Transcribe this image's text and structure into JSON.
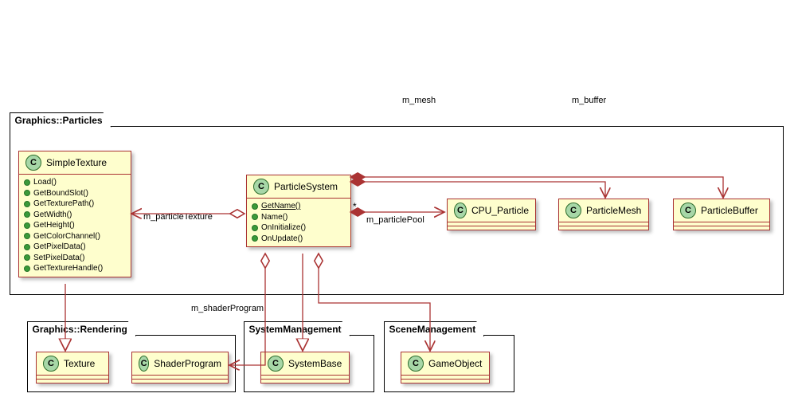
{
  "packages": {
    "particles": "Graphics::Particles",
    "rendering": "Graphics::Rendering",
    "sysmgmt": "SystemManagement",
    "scenemgmt": "SceneManagement"
  },
  "classes": {
    "stereotype": "C",
    "simpleTexture": {
      "name": "SimpleTexture",
      "members": [
        "Load()",
        "GetBoundSlot()",
        "GetTexturePath()",
        "GetWidth()",
        "GetHeight()",
        "GetColorChannel()",
        "GetPixelData()",
        "SetPixelData()",
        "GetTextureHandle()"
      ]
    },
    "particleSystem": {
      "name": "ParticleSystem",
      "members": {
        "getNameStatic": "GetName()",
        "name": "Name()",
        "onInit": "OnInitialize()",
        "onUpdate": "OnUpdate()"
      }
    },
    "cpuParticle": "CPU_Particle",
    "particleMesh": "ParticleMesh",
    "particleBuffer": "ParticleBuffer",
    "texture": "Texture",
    "shaderProgram": "ShaderProgram",
    "systemBase": "SystemBase",
    "gameObject": "GameObject"
  },
  "labels": {
    "m_mesh": "m_mesh",
    "m_buffer": "m_buffer",
    "m_particleTexture": "m_particleTexture",
    "m_particlePool": "m_particlePool",
    "m_shaderProgram": "m_shaderProgram",
    "star": "*"
  },
  "chart_data": {
    "type": "uml-class-diagram",
    "packages": [
      {
        "name": "Graphics::Particles",
        "classes": [
          "SimpleTexture",
          "ParticleSystem",
          "CPU_Particle",
          "ParticleMesh",
          "ParticleBuffer"
        ]
      },
      {
        "name": "Graphics::Rendering",
        "classes": [
          "Texture",
          "ShaderProgram"
        ]
      },
      {
        "name": "SystemManagement",
        "classes": [
          "SystemBase"
        ]
      },
      {
        "name": "SceneManagement",
        "classes": [
          "GameObject"
        ]
      }
    ],
    "classes": {
      "SimpleTexture": {
        "methods": [
          "Load()",
          "GetBoundSlot()",
          "GetTexturePath()",
          "GetWidth()",
          "GetHeight()",
          "GetColorChannel()",
          "GetPixelData()",
          "SetPixelData()",
          "GetTextureHandle()"
        ]
      },
      "ParticleSystem": {
        "methods": [
          {
            "name": "GetName()",
            "static": true
          },
          {
            "name": "Name()"
          },
          {
            "name": "OnInitialize()"
          },
          {
            "name": "OnUpdate()"
          }
        ]
      },
      "CPU_Particle": {},
      "ParticleMesh": {},
      "ParticleBuffer": {},
      "Texture": {},
      "ShaderProgram": {},
      "SystemBase": {},
      "GameObject": {}
    },
    "relationships": [
      {
        "from": "SimpleTexture",
        "to": "Texture",
        "type": "generalization"
      },
      {
        "from": "ParticleSystem",
        "to": "SystemBase",
        "type": "generalization"
      },
      {
        "from": "ParticleSystem",
        "to": "SimpleTexture",
        "type": "aggregation",
        "label": "m_particleTexture"
      },
      {
        "from": "ParticleSystem",
        "to": "ShaderProgram",
        "type": "aggregation",
        "label": "m_shaderProgram"
      },
      {
        "from": "ParticleSystem",
        "to": "GameObject",
        "type": "aggregation"
      },
      {
        "from": "ParticleSystem",
        "to": "CPU_Particle",
        "type": "composition",
        "label": "m_particlePool",
        "multiplicity": "*"
      },
      {
        "from": "ParticleSystem",
        "to": "ParticleMesh",
        "type": "composition",
        "label": "m_mesh"
      },
      {
        "from": "ParticleSystem",
        "to": "ParticleBuffer",
        "type": "composition",
        "label": "m_buffer"
      }
    ]
  }
}
